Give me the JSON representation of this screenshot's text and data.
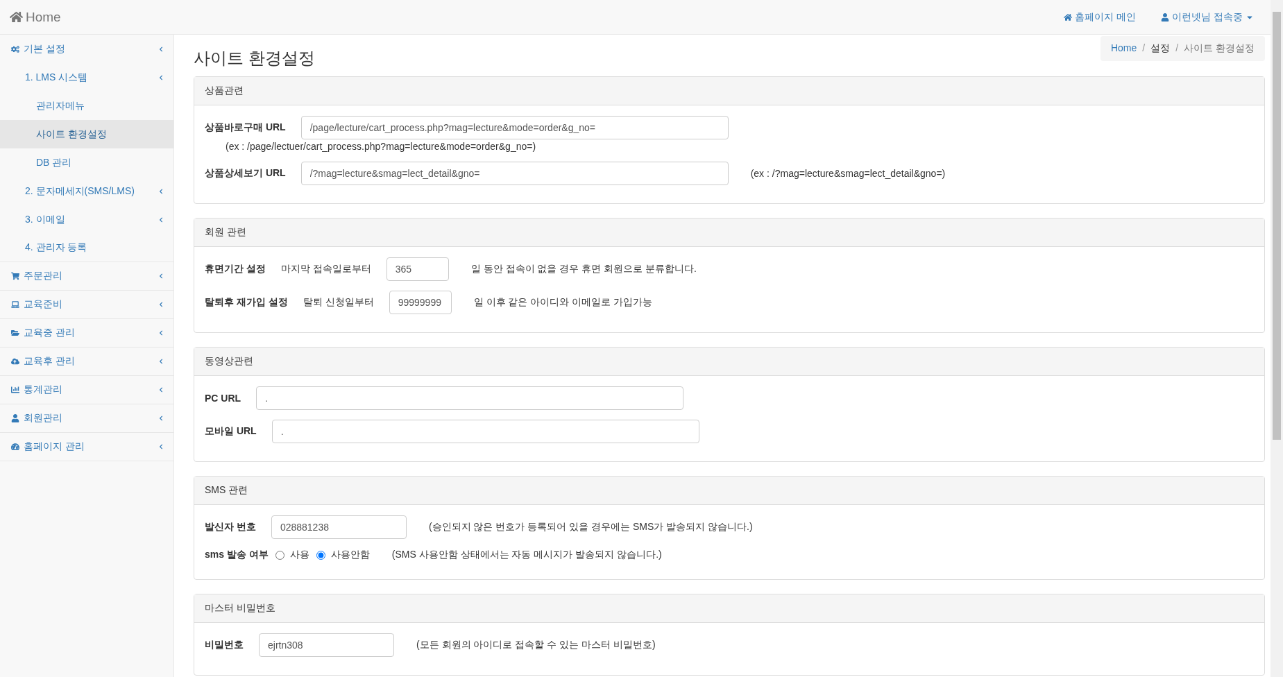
{
  "header": {
    "brand": "Home",
    "links": [
      {
        "label": "홈페이지 메인",
        "caret": false
      },
      {
        "label": "이런넷님 접속중",
        "caret": true
      }
    ]
  },
  "sidebar": {
    "items": [
      {
        "label": "기본 설정",
        "selected": false,
        "children": [
          {
            "label": "1. LMS 시스템",
            "selected": false,
            "chevron": true,
            "children": [
              {
                "label": "관리자메뉴",
                "selected": false
              },
              {
                "label": "사이트 환경설정",
                "selected": true
              },
              {
                "label": "DB 관리",
                "selected": false
              }
            ]
          },
          {
            "label": "2. 문자메세지(SMS/LMS)",
            "selected": false,
            "chevron": true
          },
          {
            "label": "3. 이메일",
            "selected": false,
            "chevron": true
          },
          {
            "label": "4. 관리자 등록",
            "selected": false,
            "chevron": false
          }
        ]
      },
      {
        "label": "주문관리",
        "selected": false
      },
      {
        "label": "교육준비",
        "selected": false
      },
      {
        "label": "교육중 관리",
        "selected": false
      },
      {
        "label": "교육후 관리",
        "selected": false
      },
      {
        "label": "통계관리",
        "selected": false
      },
      {
        "label": "회원관리",
        "selected": false
      },
      {
        "label": "홈페이지 관리",
        "selected": false
      }
    ]
  },
  "page_title": "사이트 환경설정",
  "breadcrumb_separator": "/",
  "breadcrumb": [
    {
      "label": "Home",
      "kind": "link"
    },
    {
      "label": "설정",
      "kind": "text"
    },
    {
      "label": "사이트 환경설정",
      "kind": "current"
    }
  ],
  "panels": [
    {
      "title": "상품관련",
      "rows": [
        {
          "parts": [
            {
              "kind": "label",
              "text": "상품바로구매 URL"
            },
            {
              "kind": "wide",
              "value": "/page/lecture/cart_process.php?mag=lecture&mode=order&g_no="
            }
          ],
          "note_below": "(ex : /page/lectuer/cart_process.php?mag=lecture&mode=order&g_no=)"
        },
        {
          "parts": [
            {
              "kind": "label",
              "text": "상품상세보기 URL"
            },
            {
              "kind": "wide",
              "value": "/?mag=lecture&smag=lect_detail&gno="
            },
            {
              "kind": "note",
              "text": "(ex : /?mag=lecture&smag=lect_detail&gno=)"
            }
          ]
        }
      ]
    },
    {
      "title": "회원 관련",
      "rows": [
        {
          "parts": [
            {
              "kind": "label",
              "text": "휴면기간 설정"
            },
            {
              "kind": "text",
              "text": "마지막 접속일로부터"
            },
            {
              "kind": "small",
              "value": "365"
            },
            {
              "kind": "note",
              "text": "일 동안 접속이 없을 경우 휴면 회원으로 분류합니다."
            }
          ]
        },
        {
          "parts": [
            {
              "kind": "label",
              "text": "탈퇴후 재가입 설정"
            },
            {
              "kind": "text",
              "text": "탈퇴 신청일부터"
            },
            {
              "kind": "small",
              "value": "99999999"
            },
            {
              "kind": "note",
              "text": "일 이후 같은 아이디와 이메일로 가입가능"
            }
          ]
        }
      ]
    },
    {
      "title": "동영상관련",
      "rows": [
        {
          "parts": [
            {
              "kind": "label",
              "text": "PC URL"
            },
            {
              "kind": "wide",
              "value": "."
            }
          ]
        },
        {
          "parts": [
            {
              "kind": "label",
              "text": "모바일 URL"
            },
            {
              "kind": "wide",
              "value": "."
            }
          ]
        }
      ]
    },
    {
      "title": "SMS 관련",
      "rows": [
        {
          "parts": [
            {
              "kind": "label",
              "text": "발신자 번호"
            },
            {
              "kind": "medium",
              "value": "028881238"
            },
            {
              "kind": "note",
              "text": "(승인되지 않은 번호가 등록되어 있을 경우에는 SMS가 발송되지 않습니다.)"
            }
          ]
        },
        {
          "parts": [
            {
              "kind": "label",
              "text": "sms 발송 여부"
            },
            {
              "kind": "radio",
              "text": "사용",
              "selected": false
            },
            {
              "kind": "radio",
              "text": "사용안함",
              "selected": true
            },
            {
              "kind": "note",
              "text": "(SMS 사용안함 상태에서는 자동 메시지가 발송되지 않습니다.)"
            }
          ]
        }
      ]
    },
    {
      "title": "마스터 비밀번호",
      "rows": [
        {
          "parts": [
            {
              "kind": "label",
              "text": "비밀번호"
            },
            {
              "kind": "medium",
              "value": "ejrtn308"
            },
            {
              "kind": "note",
              "text": "(모든 회원의 아이디로 접속할 수 있는 마스터 비밀번호)"
            }
          ]
        }
      ]
    }
  ]
}
